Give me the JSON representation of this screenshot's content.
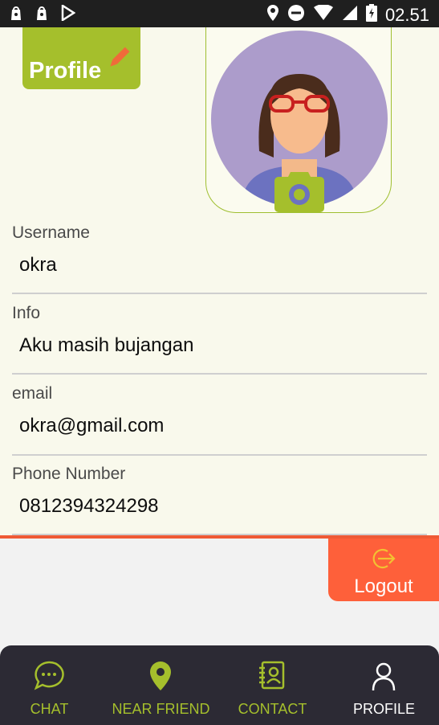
{
  "status_bar": {
    "time": "02.51"
  },
  "header": {
    "badge_label": "Profile"
  },
  "fields": [
    {
      "label": "Username",
      "value": "okra"
    },
    {
      "label": "Info",
      "value": "Aku masih bujangan"
    },
    {
      "label": "email",
      "value": "okra@gmail.com"
    },
    {
      "label": "Phone Number",
      "value": "0812394324298"
    }
  ],
  "logout": {
    "label": "Logout"
  },
  "nav": {
    "items": [
      {
        "label": "CHAT",
        "icon": "chat-bubble-icon",
        "color": "#a5bf2c"
      },
      {
        "label": "NEAR FRIEND",
        "icon": "map-pin-icon",
        "color": "#a5bf2c"
      },
      {
        "label": "CONTACT",
        "icon": "contact-book-icon",
        "color": "#a5bf2c"
      },
      {
        "label": "PROFILE",
        "icon": "person-icon",
        "color": "#ffffff"
      }
    ]
  },
  "colors": {
    "accent": "#a5bf2c",
    "logout": "#fe603a",
    "nav_bg": "#2c2a34"
  }
}
